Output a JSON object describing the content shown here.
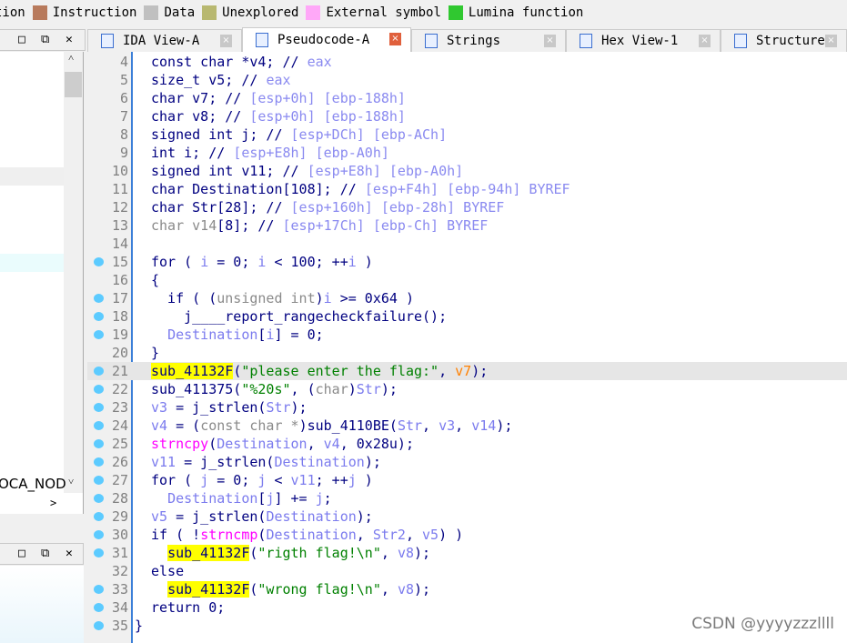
{
  "legend": [
    {
      "label": "tion",
      "color": null
    },
    {
      "label": "Instruction",
      "color": "#b87a5c"
    },
    {
      "label": "Data",
      "color": "#c0c0c0"
    },
    {
      "label": "Unexplored",
      "color": "#b8b870"
    },
    {
      "label": "External symbol",
      "color": "#ffa8f8"
    },
    {
      "label": "Lumina function",
      "color": "#30c830"
    }
  ],
  "left_panel": {
    "node_text": "OCA_NOD",
    "controls": [
      "□",
      "⧉",
      "✕"
    ]
  },
  "bottom_panel": {
    "controls": [
      "□",
      "⧉",
      "✕"
    ]
  },
  "tabs": [
    {
      "label": "IDA View-A",
      "icon": "ida-view-icon",
      "active": false
    },
    {
      "label": "Pseudocode-A",
      "icon": "pseudocode-icon",
      "active": true
    },
    {
      "label": "Strings",
      "icon": "strings-icon",
      "active": false
    },
    {
      "label": "Hex View-1",
      "icon": "hex-view-icon",
      "active": false
    },
    {
      "label": "Structures",
      "icon": "structures-icon",
      "active": false
    }
  ],
  "code": {
    "current_line": 21,
    "lines": [
      {
        "n": 4,
        "dot": false,
        "t": [
          [
            "n",
            "const char *v4; // "
          ],
          [
            "c",
            "eax"
          ]
        ]
      },
      {
        "n": 5,
        "dot": false,
        "t": [
          [
            "n",
            "size_t v5; // "
          ],
          [
            "c",
            "eax"
          ]
        ]
      },
      {
        "n": 6,
        "dot": false,
        "t": [
          [
            "n",
            "char v7; // "
          ],
          [
            "c",
            "[esp+0h] [ebp-188h]"
          ]
        ]
      },
      {
        "n": 7,
        "dot": false,
        "t": [
          [
            "n",
            "char v8; // "
          ],
          [
            "c",
            "[esp+0h] [ebp-188h]"
          ]
        ]
      },
      {
        "n": 8,
        "dot": false,
        "t": [
          [
            "n",
            "signed int j; // "
          ],
          [
            "c",
            "[esp+DCh] [ebp-ACh]"
          ]
        ]
      },
      {
        "n": 9,
        "dot": false,
        "t": [
          [
            "n",
            "int i; // "
          ],
          [
            "c",
            "[esp+E8h] [ebp-A0h]"
          ]
        ]
      },
      {
        "n": 10,
        "dot": false,
        "t": [
          [
            "n",
            "signed int v11; // "
          ],
          [
            "c",
            "[esp+E8h] [ebp-A0h]"
          ]
        ]
      },
      {
        "n": 11,
        "dot": false,
        "t": [
          [
            "n",
            "char Destination[108]; // "
          ],
          [
            "c",
            "[esp+F4h] [ebp-94h] BYREF"
          ]
        ]
      },
      {
        "n": 12,
        "dot": false,
        "t": [
          [
            "n",
            "char Str[28]; // "
          ],
          [
            "c",
            "[esp+160h] [ebp-28h] BYREF"
          ]
        ]
      },
      {
        "n": 13,
        "dot": false,
        "t": [
          [
            "g",
            "char v14"
          ],
          [
            "n",
            "[8]; // "
          ],
          [
            "c",
            "[esp+17Ch] [ebp-Ch] BYREF"
          ]
        ]
      },
      {
        "n": 14,
        "dot": false,
        "t": []
      },
      {
        "n": 15,
        "dot": true,
        "t": [
          [
            "n",
            "for ( "
          ],
          [
            "v",
            "i"
          ],
          [
            "n",
            " = 0; "
          ],
          [
            "v",
            "i"
          ],
          [
            "n",
            " < 100; ++"
          ],
          [
            "v",
            "i"
          ],
          [
            "n",
            " )"
          ]
        ]
      },
      {
        "n": 16,
        "dot": false,
        "t": [
          [
            "n",
            "{"
          ]
        ]
      },
      {
        "n": 17,
        "dot": true,
        "t": [
          [
            "n",
            "  if ( ("
          ],
          [
            "g",
            "unsigned int"
          ],
          [
            "n",
            ")"
          ],
          [
            "v",
            "i"
          ],
          [
            "n",
            " >= 0x64 )"
          ]
        ]
      },
      {
        "n": 18,
        "dot": true,
        "t": [
          [
            "n",
            "    j____report_rangecheckfailure();"
          ]
        ]
      },
      {
        "n": 19,
        "dot": true,
        "t": [
          [
            "n",
            "  "
          ],
          [
            "v",
            "Destination"
          ],
          [
            "n",
            "["
          ],
          [
            "v",
            "i"
          ],
          [
            "n",
            "] = 0;"
          ]
        ]
      },
      {
        "n": 20,
        "dot": false,
        "t": [
          [
            "n",
            "}"
          ]
        ]
      },
      {
        "n": 21,
        "dot": true,
        "t": [
          [
            "hl",
            "sub_41132F"
          ],
          [
            "n",
            "("
          ],
          [
            "s",
            "\"please enter the flag:\""
          ],
          [
            "n",
            ", "
          ],
          [
            "o",
            "v7"
          ],
          [
            "n",
            ");"
          ]
        ]
      },
      {
        "n": 22,
        "dot": true,
        "t": [
          [
            "n",
            "sub_411375("
          ],
          [
            "s",
            "\"%20s\""
          ],
          [
            "n",
            ", ("
          ],
          [
            "g",
            "char"
          ],
          [
            "n",
            ")"
          ],
          [
            "v",
            "Str"
          ],
          [
            "n",
            ");"
          ]
        ]
      },
      {
        "n": 23,
        "dot": true,
        "t": [
          [
            "v",
            "v3"
          ],
          [
            "n",
            " = j_strlen("
          ],
          [
            "v",
            "Str"
          ],
          [
            "n",
            ");"
          ]
        ]
      },
      {
        "n": 24,
        "dot": true,
        "t": [
          [
            "v",
            "v4"
          ],
          [
            "n",
            " = ("
          ],
          [
            "g",
            "const char *"
          ],
          [
            "n",
            ")sub_4110BE("
          ],
          [
            "v",
            "Str"
          ],
          [
            "n",
            ", "
          ],
          [
            "v",
            "v3"
          ],
          [
            "n",
            ", "
          ],
          [
            "v",
            "v14"
          ],
          [
            "n",
            ");"
          ]
        ]
      },
      {
        "n": 25,
        "dot": true,
        "t": [
          [
            "m",
            "strncpy"
          ],
          [
            "n",
            "("
          ],
          [
            "v",
            "Destination"
          ],
          [
            "n",
            ", "
          ],
          [
            "v",
            "v4"
          ],
          [
            "n",
            ", 0x28u);"
          ]
        ]
      },
      {
        "n": 26,
        "dot": true,
        "t": [
          [
            "v",
            "v11"
          ],
          [
            "n",
            " = j_strlen("
          ],
          [
            "v",
            "Destination"
          ],
          [
            "n",
            ");"
          ]
        ]
      },
      {
        "n": 27,
        "dot": true,
        "t": [
          [
            "n",
            "for ( "
          ],
          [
            "v",
            "j"
          ],
          [
            "n",
            " = 0; "
          ],
          [
            "v",
            "j"
          ],
          [
            "n",
            " < "
          ],
          [
            "v",
            "v11"
          ],
          [
            "n",
            "; ++"
          ],
          [
            "v",
            "j"
          ],
          [
            "n",
            " )"
          ]
        ]
      },
      {
        "n": 28,
        "dot": true,
        "t": [
          [
            "n",
            "  "
          ],
          [
            "v",
            "Destination"
          ],
          [
            "n",
            "["
          ],
          [
            "v",
            "j"
          ],
          [
            "n",
            "] += "
          ],
          [
            "v",
            "j"
          ],
          [
            "n",
            ";"
          ]
        ]
      },
      {
        "n": 29,
        "dot": true,
        "t": [
          [
            "v",
            "v5"
          ],
          [
            "n",
            " = j_strlen("
          ],
          [
            "v",
            "Destination"
          ],
          [
            "n",
            ");"
          ]
        ]
      },
      {
        "n": 30,
        "dot": true,
        "t": [
          [
            "n",
            "if ( !"
          ],
          [
            "m",
            "strncmp"
          ],
          [
            "n",
            "("
          ],
          [
            "v",
            "Destination"
          ],
          [
            "n",
            ", "
          ],
          [
            "v",
            "Str2"
          ],
          [
            "n",
            ", "
          ],
          [
            "v",
            "v5"
          ],
          [
            "n",
            ") )"
          ]
        ]
      },
      {
        "n": 31,
        "dot": true,
        "t": [
          [
            "n",
            "  "
          ],
          [
            "hl",
            "sub_41132F"
          ],
          [
            "n",
            "("
          ],
          [
            "s",
            "\"rigth flag!\\n\""
          ],
          [
            "n",
            ", "
          ],
          [
            "v",
            "v8"
          ],
          [
            "n",
            ");"
          ]
        ]
      },
      {
        "n": 32,
        "dot": false,
        "t": [
          [
            "n",
            "else"
          ]
        ]
      },
      {
        "n": 33,
        "dot": true,
        "t": [
          [
            "n",
            "  "
          ],
          [
            "hl",
            "sub_41132F"
          ],
          [
            "n",
            "("
          ],
          [
            "s",
            "\"wrong flag!\\n\""
          ],
          [
            "n",
            ", "
          ],
          [
            "v",
            "v8"
          ],
          [
            "n",
            ");"
          ]
        ]
      },
      {
        "n": 34,
        "dot": true,
        "t": [
          [
            "n",
            "return 0;"
          ]
        ]
      },
      {
        "n": 35,
        "dot": true,
        "t": [
          [
            "n",
            "}"
          ]
        ],
        "outdent": true
      }
    ]
  },
  "watermark": "CSDN @yyyyzzzllll"
}
